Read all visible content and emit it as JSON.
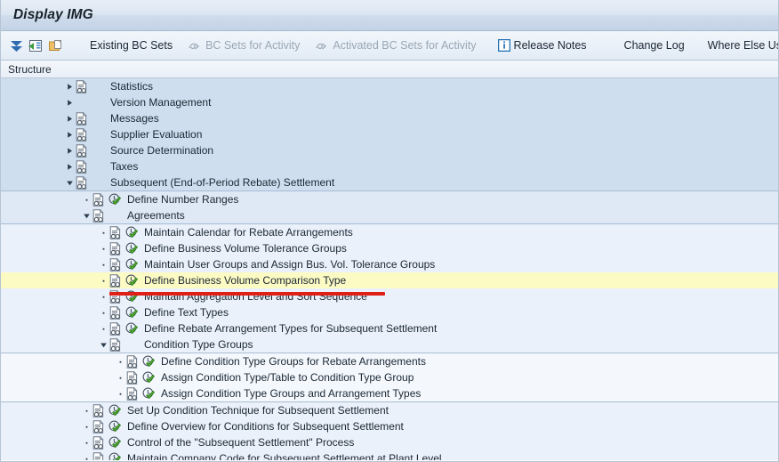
{
  "window": {
    "title": "Display IMG"
  },
  "toolbar": {
    "icons": [
      {
        "name": "collapse-all-icon",
        "glyph": "expand-collapse"
      },
      {
        "name": "expand-node-icon",
        "glyph": "green-arrow-box"
      },
      {
        "name": "copy-icon",
        "glyph": "folder-copy"
      }
    ],
    "buttons": [
      {
        "name": "existing-bc-sets-button",
        "label": "Existing BC Sets",
        "disabled": false,
        "icon": ""
      },
      {
        "name": "bc-sets-for-activity-button",
        "label": "BC Sets for Activity",
        "disabled": true,
        "icon": "bc-set-icon"
      },
      {
        "name": "activated-bc-sets-for-activity-button",
        "label": "Activated BC Sets for Activity",
        "disabled": true,
        "icon": "bc-set-icon"
      },
      {
        "name": "release-notes-button",
        "label": "Release Notes",
        "disabled": false,
        "icon": "info-icon"
      },
      {
        "name": "change-log-button",
        "label": "Change Log",
        "disabled": false,
        "icon": ""
      },
      {
        "name": "where-else-used-button",
        "label": "Where Else Used",
        "disabled": false,
        "icon": ""
      }
    ]
  },
  "structure": {
    "header": "Structure",
    "rows": [
      {
        "name": "tree-node-statistics",
        "label": "Statistics",
        "indent": 0,
        "twisty": "collapsed",
        "doc": true,
        "action": false,
        "band": 1
      },
      {
        "name": "tree-node-version-management",
        "label": "Version Management",
        "indent": 0,
        "twisty": "collapsed",
        "doc": false,
        "action": false,
        "band": 1
      },
      {
        "name": "tree-node-messages",
        "label": "Messages",
        "indent": 0,
        "twisty": "collapsed",
        "doc": true,
        "action": false,
        "band": 1
      },
      {
        "name": "tree-node-supplier-evaluation",
        "label": "Supplier Evaluation",
        "indent": 0,
        "twisty": "collapsed",
        "doc": true,
        "action": false,
        "band": 1
      },
      {
        "name": "tree-node-source-determination",
        "label": "Source Determination",
        "indent": 0,
        "twisty": "collapsed",
        "doc": true,
        "action": false,
        "band": 1
      },
      {
        "name": "tree-node-taxes",
        "label": "Taxes",
        "indent": 0,
        "twisty": "collapsed",
        "doc": true,
        "action": false,
        "band": 1
      },
      {
        "name": "tree-node-subsequent-settlement",
        "label": "Subsequent (End-of-Period Rebate) Settlement",
        "indent": 0,
        "twisty": "expanded",
        "doc": true,
        "action": false,
        "band": 1
      },
      {
        "name": "tree-node-define-number-ranges",
        "label": "Define Number Ranges",
        "indent": 1,
        "twisty": "leaf",
        "doc": true,
        "action": true,
        "band": 2
      },
      {
        "name": "tree-node-agreements",
        "label": "Agreements",
        "indent": 1,
        "twisty": "expanded",
        "doc": true,
        "action": false,
        "band": 2
      },
      {
        "name": "tree-node-maintain-calendar-for-rebate-arrangements",
        "label": "Maintain Calendar for Rebate Arrangements",
        "indent": 2,
        "twisty": "leaf",
        "doc": true,
        "action": true,
        "band": 3
      },
      {
        "name": "tree-node-define-business-volume-tolerance-groups",
        "label": "Define Business Volume Tolerance Groups",
        "indent": 2,
        "twisty": "leaf",
        "doc": true,
        "action": true,
        "band": 3
      },
      {
        "name": "tree-node-maintain-user-groups-and-assign-bus-vol-tolerance-groups",
        "label": "Maintain User Groups and Assign Bus. Vol. Tolerance Groups",
        "indent": 2,
        "twisty": "leaf",
        "doc": true,
        "action": true,
        "band": 3
      },
      {
        "name": "tree-node-define-business-volume-comparison-type",
        "label": "Define Business Volume Comparison Type",
        "indent": 2,
        "twisty": "leaf",
        "doc": true,
        "action": true,
        "band": 3,
        "highlight": true
      },
      {
        "name": "tree-node-maintain-aggregation-level-and-sort-sequence",
        "label": "Maintain Aggregation Level and Sort Sequence",
        "indent": 2,
        "twisty": "leaf",
        "doc": true,
        "action": true,
        "band": 3
      },
      {
        "name": "tree-node-define-text-types",
        "label": "Define Text Types",
        "indent": 2,
        "twisty": "leaf",
        "doc": true,
        "action": true,
        "band": 3
      },
      {
        "name": "tree-node-define-rebate-arrangement-types-for-subsequent-settlement",
        "label": "Define Rebate Arrangement Types for Subsequent Settlement",
        "indent": 2,
        "twisty": "leaf",
        "doc": true,
        "action": true,
        "band": 3
      },
      {
        "name": "tree-node-condition-type-groups",
        "label": "Condition Type Groups",
        "indent": 2,
        "twisty": "expanded",
        "doc": true,
        "action": false,
        "band": 3
      },
      {
        "name": "tree-node-define-condition-type-groups-for-rebate-arrangements",
        "label": "Define Condition Type Groups for Rebate Arrangements",
        "indent": 3,
        "twisty": "leaf",
        "doc": true,
        "action": true,
        "band": 4
      },
      {
        "name": "tree-node-assign-condition-type-table-to-condition-type-group",
        "label": "Assign Condition Type/Table to Condition Type Group",
        "indent": 3,
        "twisty": "leaf",
        "doc": true,
        "action": true,
        "band": 4
      },
      {
        "name": "tree-node-assign-condition-type-groups-and-arrangement-types",
        "label": "Assign Condition Type Groups and Arrangement Types",
        "indent": 3,
        "twisty": "leaf",
        "doc": true,
        "action": true,
        "band": 4
      },
      {
        "name": "tree-node-set-up-condition-technique-for-subsequent-settlement",
        "label": "Set Up Condition Technique for Subsequent Settlement",
        "indent": 1,
        "twisty": "leaf",
        "doc": true,
        "action": true,
        "band": 5
      },
      {
        "name": "tree-node-define-overview-for-conditions-for-subsequent-settlement",
        "label": "Define Overview for Conditions for Subsequent Settlement",
        "indent": 1,
        "twisty": "leaf",
        "doc": true,
        "action": true,
        "band": 5
      },
      {
        "name": "tree-node-control-of-the-subsequent-settlement-process",
        "label": "Control of the \"Subsequent Settlement\" Process",
        "indent": 1,
        "twisty": "leaf",
        "doc": true,
        "action": true,
        "band": 5
      },
      {
        "name": "tree-node-maintain-company-code-for-subsequent-settlement-at-plant-level",
        "label": "Maintain Company Code for Subsequent Settlement at Plant Level",
        "indent": 1,
        "twisty": "leaf",
        "doc": true,
        "action": true,
        "band": 5
      }
    ]
  },
  "annotation": {
    "name": "red-underline-annotation",
    "color": "#e01f16",
    "targets": "tree-node-define-business-volume-comparison-type"
  }
}
